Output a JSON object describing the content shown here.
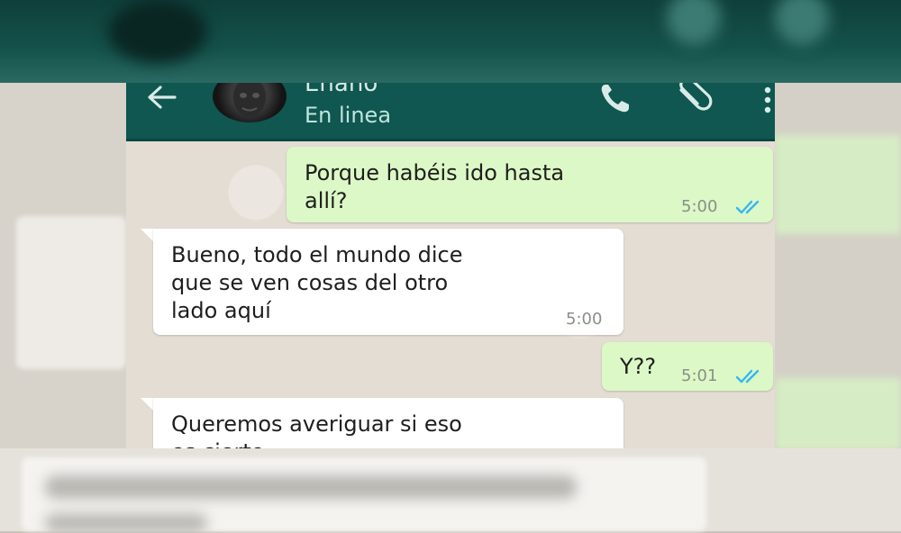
{
  "chat": {
    "contact_name": "Enano",
    "contact_status": "En linea",
    "messages": [
      {
        "direction": "outgoing",
        "text": "Porque habéis ido hasta\nallí?",
        "time": "5:00",
        "read": true
      },
      {
        "direction": "incoming",
        "text": "Bueno, todo el mundo dice\nque se ven cosas del otro\nlado aquí",
        "time": "5:00"
      },
      {
        "direction": "outgoing",
        "text": "Y??",
        "time": "5:01",
        "read": true
      },
      {
        "direction": "incoming",
        "text": "Queremos averiguar si eso\nes cierto"
      }
    ]
  },
  "icons": {
    "back": "arrow-left-icon",
    "call": "phone-icon",
    "attach": "paperclip-icon",
    "more": "more-vertical-icon",
    "read_receipt": "double-check-icon"
  },
  "colors": {
    "header": "#0f5750",
    "outgoing_bubble": "#dcf8c6",
    "incoming_bubble": "#ffffff",
    "read_ticks": "#34b7f1"
  }
}
